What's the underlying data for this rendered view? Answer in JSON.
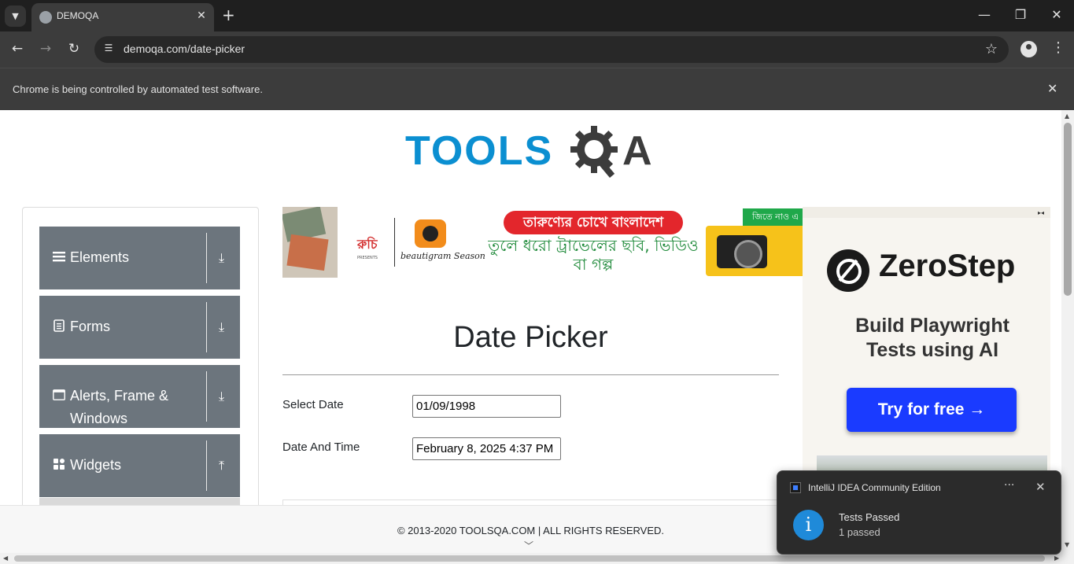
{
  "browser": {
    "tab_title": "DEMOQA",
    "tab_close_glyph": "✕",
    "new_tab_glyph": "+",
    "url_host": "demoqa.com",
    "url_path": "/date-picker",
    "infobar_text": "Chrome is being controlled by automated test software.",
    "icons": {
      "tab_search": "chevron-down-icon",
      "back": "arrow-left-icon",
      "forward": "arrow-right-icon",
      "reload": "reload-icon",
      "site_info": "tune-icon",
      "bookmark": "star-icon",
      "profile": "person-icon",
      "menu": "more-vert-icon",
      "minimize": "minimize-icon",
      "maximize": "restore-icon",
      "close": "close-icon"
    }
  },
  "logo": {
    "tools": "TOOLS",
    "qa_letter": "A",
    "colors": {
      "tools": "#0b8fd1",
      "qa": "#3c3c3c"
    }
  },
  "sidebar": {
    "groups": [
      {
        "label": "Elements",
        "icon": "hamburger-icon",
        "toggle": "expand-icon"
      },
      {
        "label": "Forms",
        "icon": "document-icon",
        "toggle": "expand-icon"
      },
      {
        "label": "Alerts, Frame & Windows",
        "icon": "window-icon",
        "toggle": "expand-icon"
      },
      {
        "label": "Widgets",
        "icon": "grid-icon",
        "toggle": "collapse-icon"
      }
    ],
    "group_color": "#6c757d"
  },
  "banner": {
    "brand": "রুচি",
    "brand_sub": "PRESENTS",
    "campaign": "beautigram Season",
    "headline": "তারুণ্যের চোখে বাংলাদেশ",
    "subline": "তুলে ধরো ট্রাভেলের ছবি, ভিডিও বা গল্প",
    "corner_text": "জিতে নাও এ"
  },
  "main": {
    "title": "Date Picker",
    "fields": [
      {
        "label": "Select Date",
        "value": "01/09/1998"
      },
      {
        "label": "Date And Time",
        "value": "February 8, 2025 4:37 PM"
      }
    ]
  },
  "right_ad": {
    "brand": "ZeroStep",
    "tagline": "Build Playwright Tests using AI",
    "cta": "Try for free →",
    "close_glyph": "▸◂",
    "cta_color": "#1a3bff"
  },
  "footer": {
    "text": "© 2013-2020 TOOLSQA.COM | ALL RIGHTS RESERVED."
  },
  "toast": {
    "app_name": "IntelliJ IDEA Community Edition",
    "title": "Tests Passed",
    "body": "1 passed",
    "info_glyph": "i",
    "more_glyph": "···",
    "close_glyph": "✕"
  }
}
